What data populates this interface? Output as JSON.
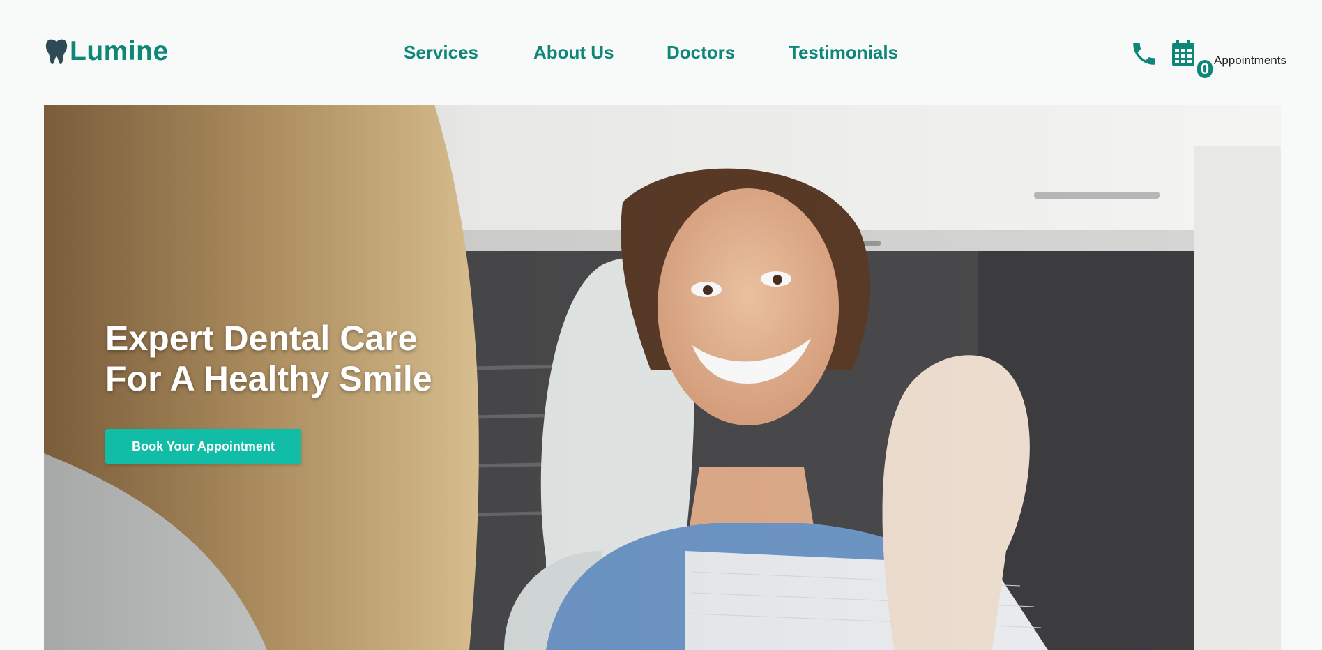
{
  "brand": {
    "name": "Lumine",
    "icon": "tooth-icon",
    "color": "#0e8779"
  },
  "nav": {
    "items": [
      {
        "label": "Services"
      },
      {
        "label": "About Us"
      },
      {
        "label": "Doctors"
      },
      {
        "label": "Testimonials"
      }
    ]
  },
  "header_actions": {
    "phone_icon": "phone-icon",
    "calendar_icon": "calendar-icon",
    "appointments_count": "0",
    "appointments_label": "Appointments"
  },
  "hero": {
    "title_line1": "Expert Dental Care",
    "title_line2": "For A Healthy Smile",
    "cta_label": "Book Your Appointment",
    "cta_color": "#12bda8",
    "image": "dentist-examining-smiling-patient-photo"
  }
}
